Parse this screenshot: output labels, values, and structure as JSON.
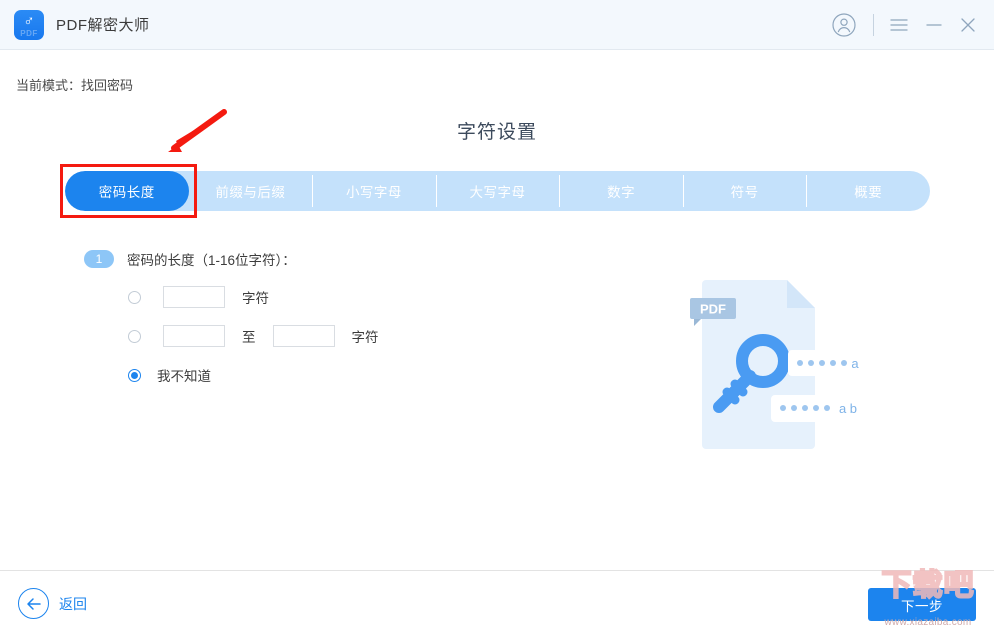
{
  "titlebar": {
    "app_name": "PDF解密大师",
    "logo_sub": "PDF",
    "icons": {
      "avatar": "user-avatar-icon",
      "menu": "hamburger-menu-icon",
      "minimize": "minimize-icon",
      "close": "close-icon"
    }
  },
  "mode": {
    "text": "当前模式：找回密码"
  },
  "page": {
    "title": "字符设置"
  },
  "tabs": [
    {
      "label": "密码长度",
      "active": true
    },
    {
      "label": "前缀与后缀",
      "active": false
    },
    {
      "label": "小写字母",
      "active": false
    },
    {
      "label": "大写字母",
      "active": false
    },
    {
      "label": "数字",
      "active": false
    },
    {
      "label": "符号",
      "active": false
    },
    {
      "label": "概要",
      "active": false
    }
  ],
  "form": {
    "step_number": "1",
    "step_label": "密码的长度（1-16位字符）：",
    "option_exact": {
      "value": "",
      "placeholder": "",
      "unit": "字符",
      "selected": false
    },
    "option_range": {
      "from_value": "",
      "to_value": "",
      "from_placeholder": "",
      "to_placeholder": "",
      "separator": "至",
      "unit": "字符",
      "selected": false
    },
    "option_unknown": {
      "label": "我不知道",
      "selected": true
    }
  },
  "illustration": {
    "file_badge": "PDF",
    "password_hint_1": "a",
    "password_hint_2": "a b",
    "key_icon": "key-icon"
  },
  "footer": {
    "back_label": "返回",
    "next_label": "下一步"
  },
  "watermark": {
    "brand": "下载吧",
    "url": "www.xiazaiba.com"
  },
  "colors": {
    "accent": "#1c84ee",
    "tab_inactive": "#c4e1fb",
    "annotation_red": "#f41a10",
    "header_bg": "#f3f8fd",
    "badge": "#8dc6f7"
  }
}
